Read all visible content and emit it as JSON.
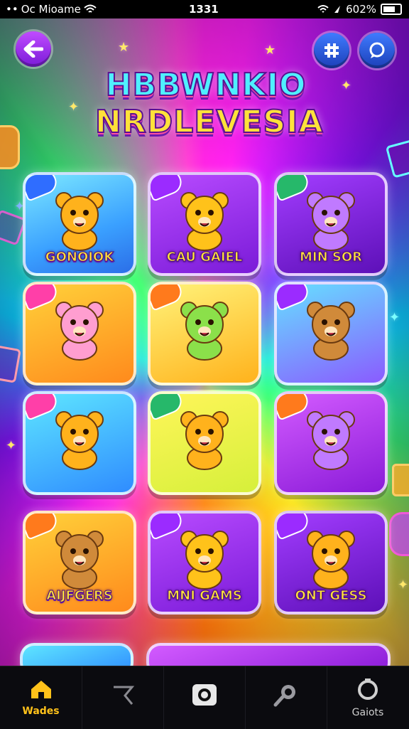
{
  "status_bar": {
    "carrier": "Oc Mioame",
    "time": "1331",
    "battery": "602%"
  },
  "header": {
    "back_icon": "arrow-left-icon",
    "grid_icon": "hash-icon",
    "chat_icon": "chat-icon",
    "title_line1": "HBBWNKIO",
    "title_line2": "NRDLEVESIA"
  },
  "tiles": [
    {
      "label": "GONOIOK",
      "badge": "",
      "color": "blue"
    },
    {
      "label": "CAU GAIEL",
      "badge": "",
      "color": "purple"
    },
    {
      "label": "MIN SOR",
      "badge": "",
      "color": "grape"
    },
    {
      "label": "",
      "badge": "",
      "color": "orange"
    },
    {
      "label": "",
      "badge": "",
      "color": "yellow"
    },
    {
      "label": "",
      "badge": "",
      "color": "sky"
    },
    {
      "label": "",
      "badge": "",
      "color": "cyan"
    },
    {
      "label": "",
      "badge": "",
      "color": "lime"
    },
    {
      "label": "",
      "badge": "",
      "color": "magenta"
    },
    {
      "label": "AIJFGERS",
      "badge": "",
      "color": "orange"
    },
    {
      "label": "MNI GAMS",
      "badge": "",
      "color": "purple"
    },
    {
      "label": "ONT GESS",
      "badge": "",
      "color": "grape"
    }
  ],
  "nav": [
    {
      "label": "Wades",
      "icon": "home-icon",
      "active": true
    },
    {
      "label": "",
      "icon": "flag-icon",
      "active": false
    },
    {
      "label": "",
      "icon": "camera-icon",
      "active": false
    },
    {
      "label": "",
      "icon": "search-icon",
      "active": false
    },
    {
      "label": "Gaiots",
      "icon": "settings-icon",
      "active": false
    }
  ]
}
